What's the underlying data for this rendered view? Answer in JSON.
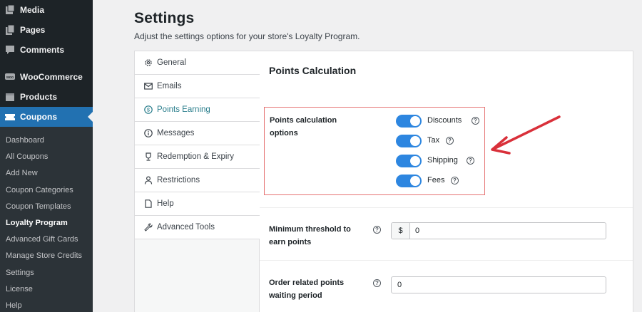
{
  "sidebar": {
    "top_items": [
      {
        "label": "Media",
        "icon": "media-icon"
      },
      {
        "label": "Pages",
        "icon": "pages-icon"
      },
      {
        "label": "Comments",
        "icon": "comments-icon"
      },
      {
        "label": "WooCommerce",
        "icon": "woocommerce-icon"
      },
      {
        "label": "Products",
        "icon": "products-icon"
      },
      {
        "label": "Coupons",
        "icon": "coupons-icon",
        "current": true
      }
    ],
    "submenu": [
      "Dashboard",
      "All Coupons",
      "Add New",
      "Coupon Categories",
      "Coupon Templates",
      "Loyalty Program",
      "Advanced Gift Cards",
      "Manage Store Credits",
      "Settings",
      "License",
      "Help"
    ],
    "submenu_active": "Loyalty Program"
  },
  "page": {
    "title": "Settings",
    "subtitle": "Adjust the settings options for your store's Loyalty Program."
  },
  "tabs": [
    {
      "label": "General",
      "icon": "gear-icon"
    },
    {
      "label": "Emails",
      "icon": "envelope-icon"
    },
    {
      "label": "Points Earning",
      "icon": "dollar-circle-icon",
      "active": true
    },
    {
      "label": "Messages",
      "icon": "info-circle-icon"
    },
    {
      "label": "Redemption & Expiry",
      "icon": "trophy-icon"
    },
    {
      "label": "Restrictions",
      "icon": "user-icon"
    },
    {
      "label": "Help",
      "icon": "doc-icon"
    },
    {
      "label": "Advanced Tools",
      "icon": "wrench-icon"
    }
  ],
  "main": {
    "section_title": "Points Calculation",
    "calc_label": "Points calculation options",
    "toggles": [
      {
        "label": "Discounts",
        "on": true
      },
      {
        "label": "Tax",
        "on": true
      },
      {
        "label": "Shipping",
        "on": true
      },
      {
        "label": "Fees",
        "on": true
      }
    ],
    "threshold_label": "Minimum threshold to earn points",
    "threshold_prefix": "$",
    "threshold_value": "0",
    "waiting_label": "Order related points waiting period",
    "waiting_value": "0",
    "help_glyph": "?"
  },
  "colors": {
    "toggle_on": "#2d86e0",
    "highlight_border": "#e57373",
    "arrow": "#d9303a",
    "active_tab": "#2a7e8c",
    "admin_current": "#2271b1"
  }
}
